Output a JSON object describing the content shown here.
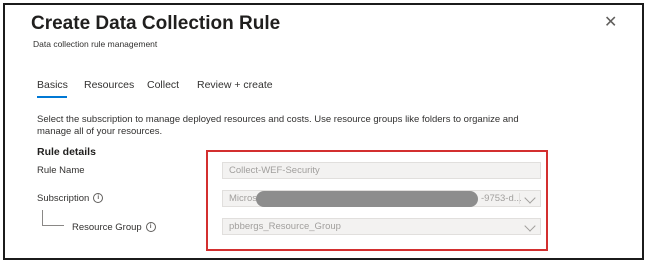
{
  "header": {
    "title": "Create Data Collection Rule",
    "subtitle": "Data collection rule management",
    "close_glyph": "✕"
  },
  "tabs": [
    {
      "label": "Basics",
      "active": true
    },
    {
      "label": "Resources",
      "active": false
    },
    {
      "label": "Collect",
      "active": false
    },
    {
      "label": "Review + create",
      "active": false
    }
  ],
  "description": "Select the subscription to manage deployed resources and costs. Use resource groups like folders to organize and manage all of your resources.",
  "section_title": "Rule details",
  "fields": {
    "rule_name": {
      "label": "Rule Name",
      "value": "Collect-WEF-Security"
    },
    "subscription": {
      "label": "Subscription",
      "value_prefix": "Micros",
      "value_suffix": "-9753-d..."
    },
    "resource_group": {
      "label": "Resource Group",
      "value": "pbbergs_Resource_Group"
    }
  },
  "icons": {
    "info": "info-icon",
    "close": "close-icon",
    "dropdown": "chevron-down-icon"
  },
  "colors": {
    "accent": "#0078d4",
    "highlight_border": "#d32f2f",
    "redaction": "#8d8d8d"
  }
}
